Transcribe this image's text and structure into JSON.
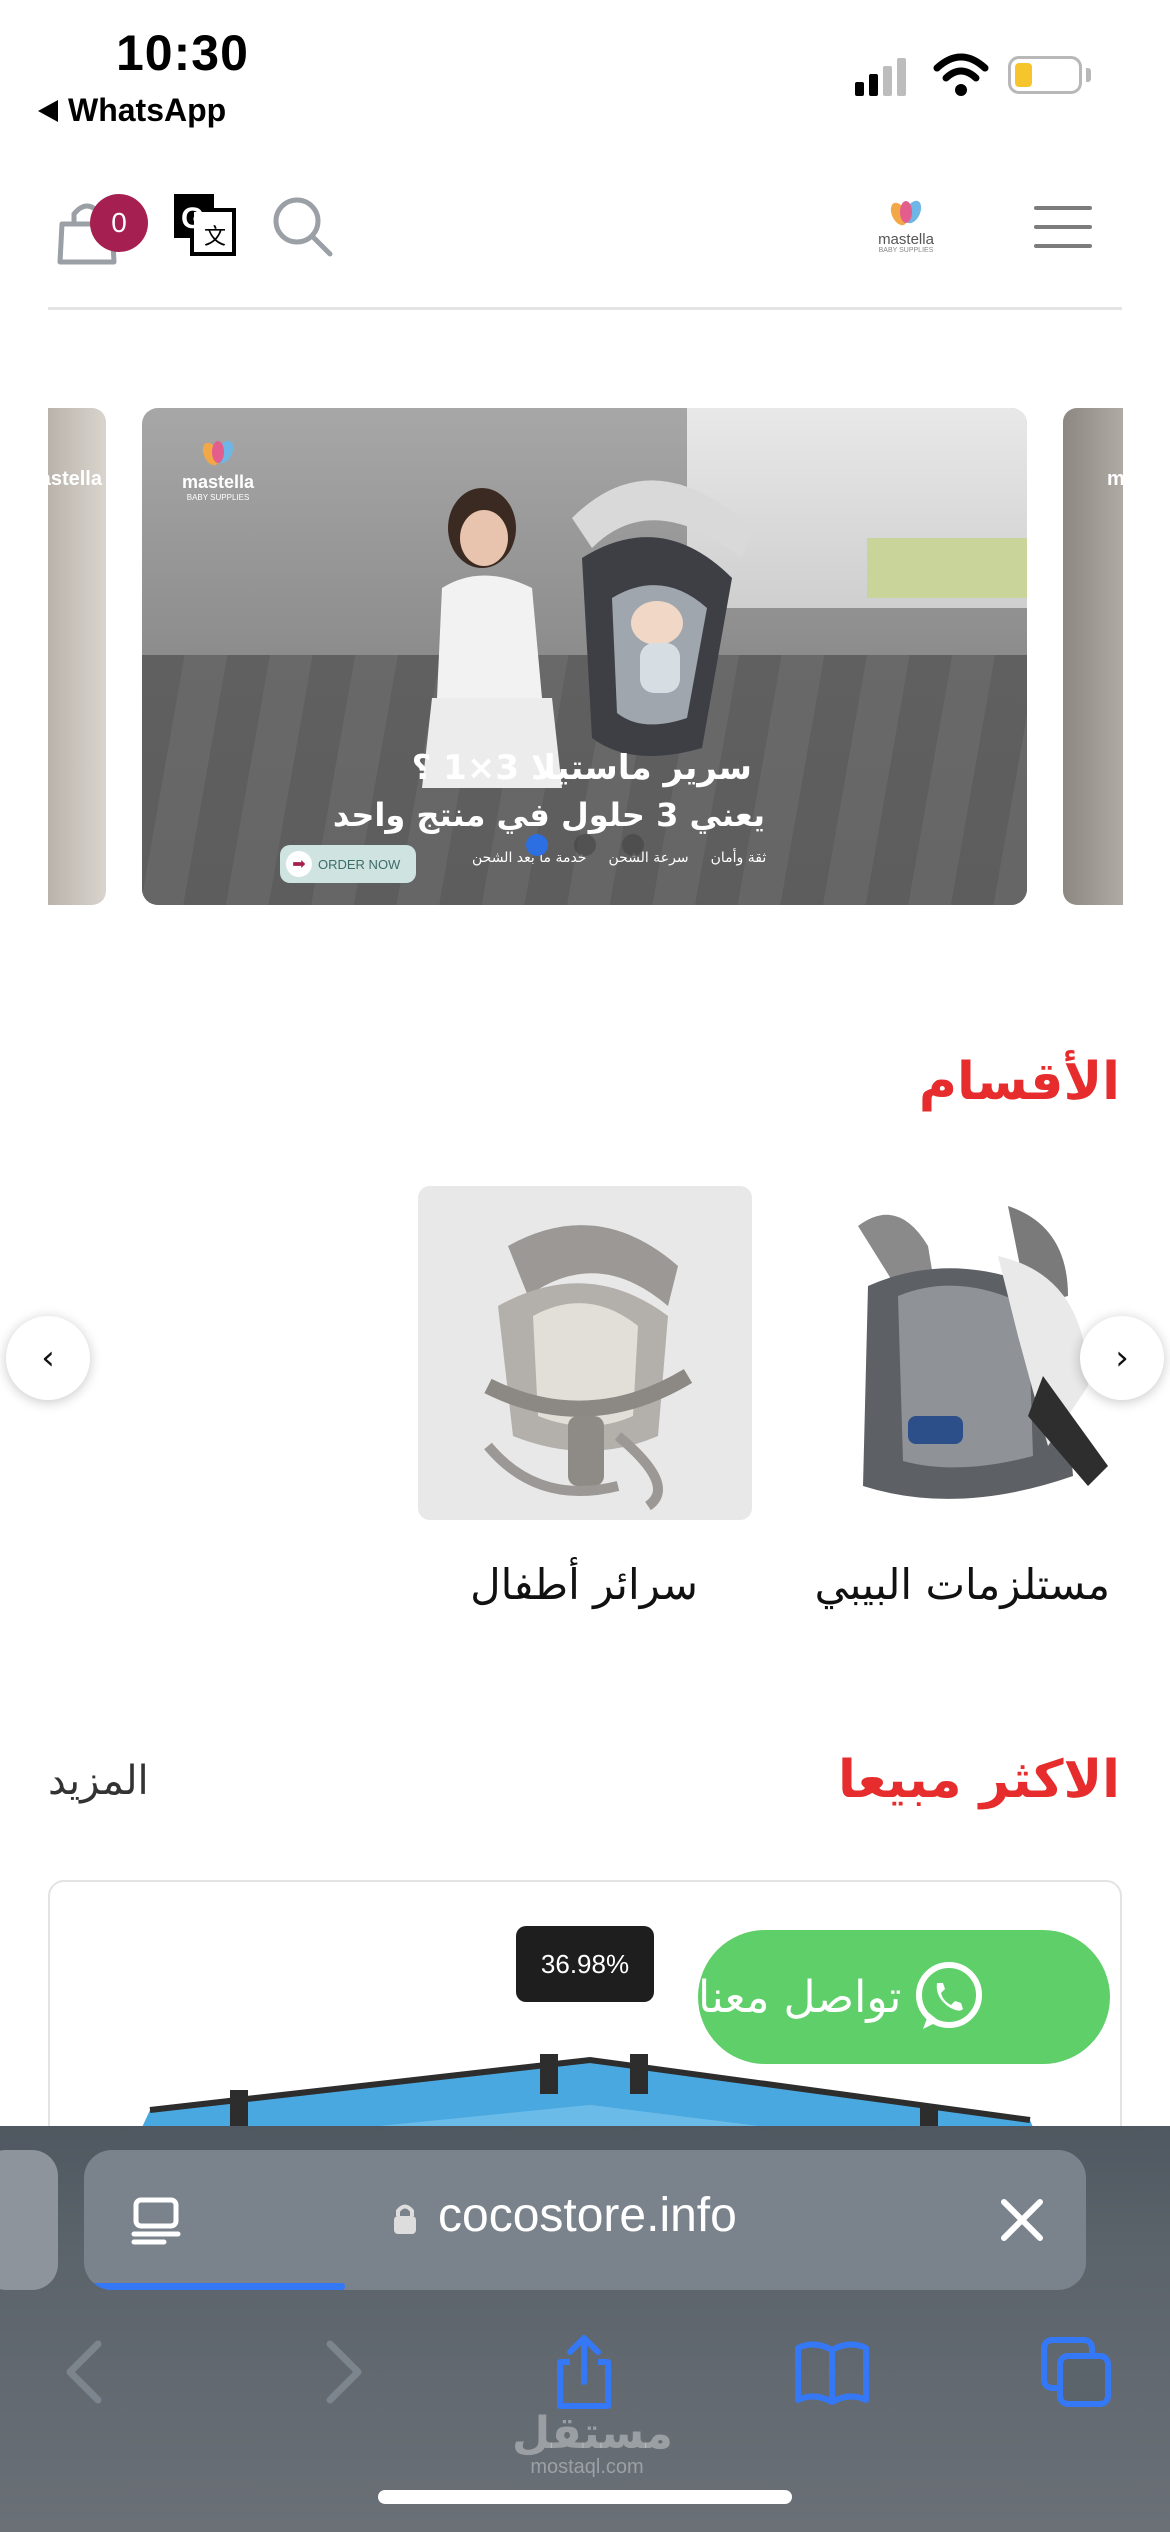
{
  "status_bar": {
    "time": "10:30",
    "back_app": "WhatsApp",
    "battery_level": 0.25
  },
  "header": {
    "cart_count": "0",
    "logo_text": "mastella",
    "logo_sub": "BABY SUPPLIES"
  },
  "banner": {
    "logo_text": "mastella",
    "logo_sub": "BABY SUPPLIES",
    "headline_1": "سرير ماستيلا 3×1 ؟",
    "headline_2": "يعني 3 حلول في منتج واحد",
    "order_now": "ORDER NOW",
    "features": [
      "ثقة وأمان",
      "سرعة الشحن",
      "خدمة ما بعد الشحن"
    ],
    "dots": 3,
    "active_dot": 0
  },
  "categories": {
    "title": "الأقسام",
    "items": [
      {
        "name": "مستلزمات البيبي"
      },
      {
        "name": "سرائر أطفال"
      }
    ],
    "prev_arrow": "‹",
    "next_arrow": "›"
  },
  "best_sellers": {
    "title": "الاكثر مبيعا",
    "more_label": "المزيد",
    "product": {
      "discount": "36.98%"
    }
  },
  "whatsapp": {
    "label": "تواصل معنا"
  },
  "safari": {
    "url": "cocostore.info",
    "load_progress": 0.26
  },
  "watermark": {
    "arabic": "مستقل",
    "latin": "mostaql.com"
  },
  "colors": {
    "accent_red": "#e62c2c",
    "badge": "#a52050",
    "whatsapp": "#5fcf6a",
    "safari_blue": "#3478f6"
  }
}
